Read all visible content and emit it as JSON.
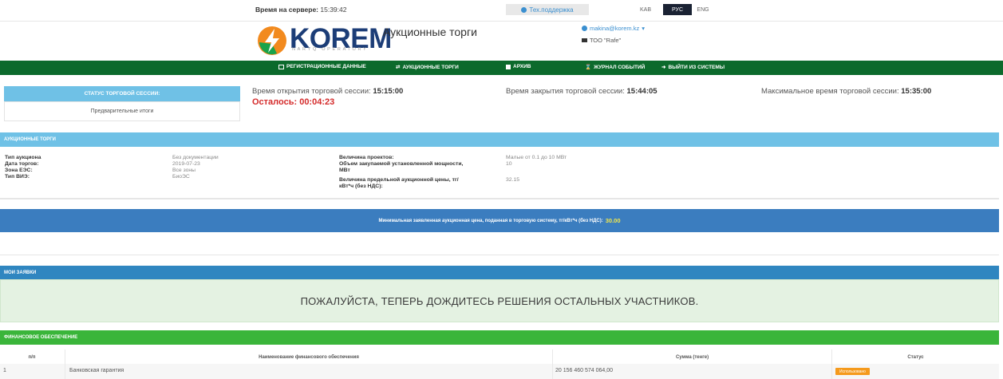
{
  "topbar": {
    "server_time_label": "Время на сервере:",
    "server_time_value": "15:39:42",
    "support_label": "Тех.поддержка",
    "langs": [
      "KAB",
      "РУС",
      "ENG"
    ],
    "active_lang": "РУС"
  },
  "header": {
    "logo_text": "KOREM",
    "logo_sub": "NARYQ OPERATORY",
    "title": "Аукционные торги",
    "user_email": "makina@korem.kz",
    "user_org": "ТОО \"Rafe\""
  },
  "nav": [
    {
      "label": "Регистрационные данные",
      "icon": "id-card-icon"
    },
    {
      "label": "Аукционные торги",
      "icon": "swap-icon"
    },
    {
      "label": "Архив",
      "icon": "archive-icon"
    },
    {
      "label": "Журнал событий",
      "icon": "hourglass-icon"
    },
    {
      "label": "Выйти из системы",
      "icon": "logout-icon"
    }
  ],
  "session": {
    "status_title": "СТАТУС ТОРГОВОЙ СЕССИИ:",
    "status_value": "Предварительные итоги",
    "open_label": "Время открытия торговой сессии:",
    "open_value": "15:15:00",
    "remaining": "Осталось: 00:04:23",
    "close_label": "Время закрытия торговой сессии:",
    "close_value": "15:44:05",
    "max_label": "Максимальное время торговой сессии:",
    "max_value": "15:35:00"
  },
  "auction": {
    "title": "АУКЦИОННЫЕ ТОРГИ",
    "left": [
      {
        "label": "Тип аукциона",
        "value": "Без документации"
      },
      {
        "label": "Дата торгов:",
        "value": "2019-07-23"
      },
      {
        "label": "Зона ЕЭС:",
        "value": "Все зоны"
      },
      {
        "label": "Тип ВИЭ:",
        "value": "БиоЭС"
      }
    ],
    "right": [
      {
        "label": "Величина проектов:",
        "value": "Малые от 0.1 до 10 МВт"
      },
      {
        "label": "Объем закупаемой установленной мощности,",
        "label2": "МВт",
        "value": "10"
      },
      {
        "label": "Величина предельной аукционной цены, тг/",
        "label2": "кВт*ч (без НДС):",
        "value": "32.15"
      }
    ],
    "min_price_label": "Минимальная заявленная аукционная цена, поданная в торговую систему, тг/кВт*ч (без НДС):",
    "min_price_value": "30.00"
  },
  "my_bids": {
    "title": "МОИ ЗАЯВКИ",
    "message": "ПОЖАЛУЙСТА, ТЕПЕРЬ ДОЖДИТЕСЬ РЕШЕНИЯ ОСТАЛЬНЫХ УЧАСТНИКОВ."
  },
  "financial": {
    "title": "ФИНАНСОВОЕ ОБЕСПЕЧЕНИЕ",
    "columns": [
      "п/п",
      "Наименование финансового обеспечения",
      "Сумма (тенге)",
      "Статус"
    ],
    "rows": [
      {
        "num": "1",
        "name": "Банковская гарантия",
        "amount": "20 156 460 574 064,00",
        "status": "Использовано"
      }
    ]
  },
  "colors": {
    "nav_green": "#0c6a2c",
    "section_blue": "#6fc1e6",
    "minprice_blue": "#3b7dbf",
    "my_bids_blue": "#2f86c0",
    "financial_green": "#3ab53a",
    "remaining_red": "#d42a2a",
    "status_orange": "#f59a1c"
  }
}
